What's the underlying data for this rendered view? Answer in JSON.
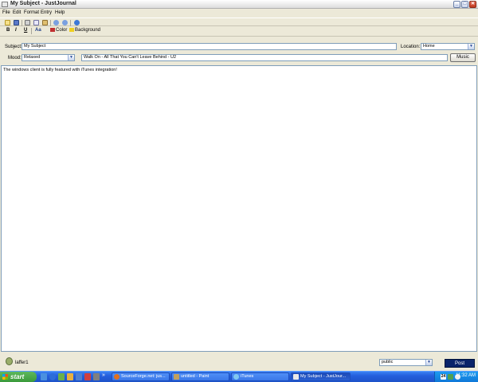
{
  "window": {
    "title": "My Subject - JustJournal",
    "controls": {
      "minimize": "_",
      "maximize": "□",
      "close": "✕"
    }
  },
  "menu": [
    "File",
    "Edit",
    "Format",
    "Entry",
    "Help"
  ],
  "format_toolbar": {
    "bold": "B",
    "italic": "I",
    "underline": "U",
    "font": "Aa",
    "color_label": "Color",
    "background_label": "Background"
  },
  "form": {
    "subject_label": "Subject:",
    "subject_value": "My Subject",
    "location_label": "Location:",
    "location_value": "Home",
    "mood_label": "Mood:",
    "mood_value": "Relaxed",
    "music_value": "Walk On - All That You Can't Leave Behind - U2",
    "music_button": "Music"
  },
  "editor": {
    "body": "The windows client is fully featured with iTunes integration!"
  },
  "status": {
    "username": "laffer1",
    "security_value": "public",
    "post_button": "Post"
  },
  "taskbar": {
    "start_label": "start",
    "chevron": "»",
    "tasks": [
      {
        "label": "SourceForge.net: jus..."
      },
      {
        "label": "untitled - Paint"
      },
      {
        "label": "iTunes"
      },
      {
        "label": "My Subject - JustJour..."
      }
    ],
    "tray_badge": "24",
    "clock": "11:32 AM"
  },
  "colors": {
    "window_bg": "#ECE9D8",
    "taskbar_blue": "#245EDC",
    "post_button": "#0A246A",
    "start_green": "#3A9A3A"
  }
}
